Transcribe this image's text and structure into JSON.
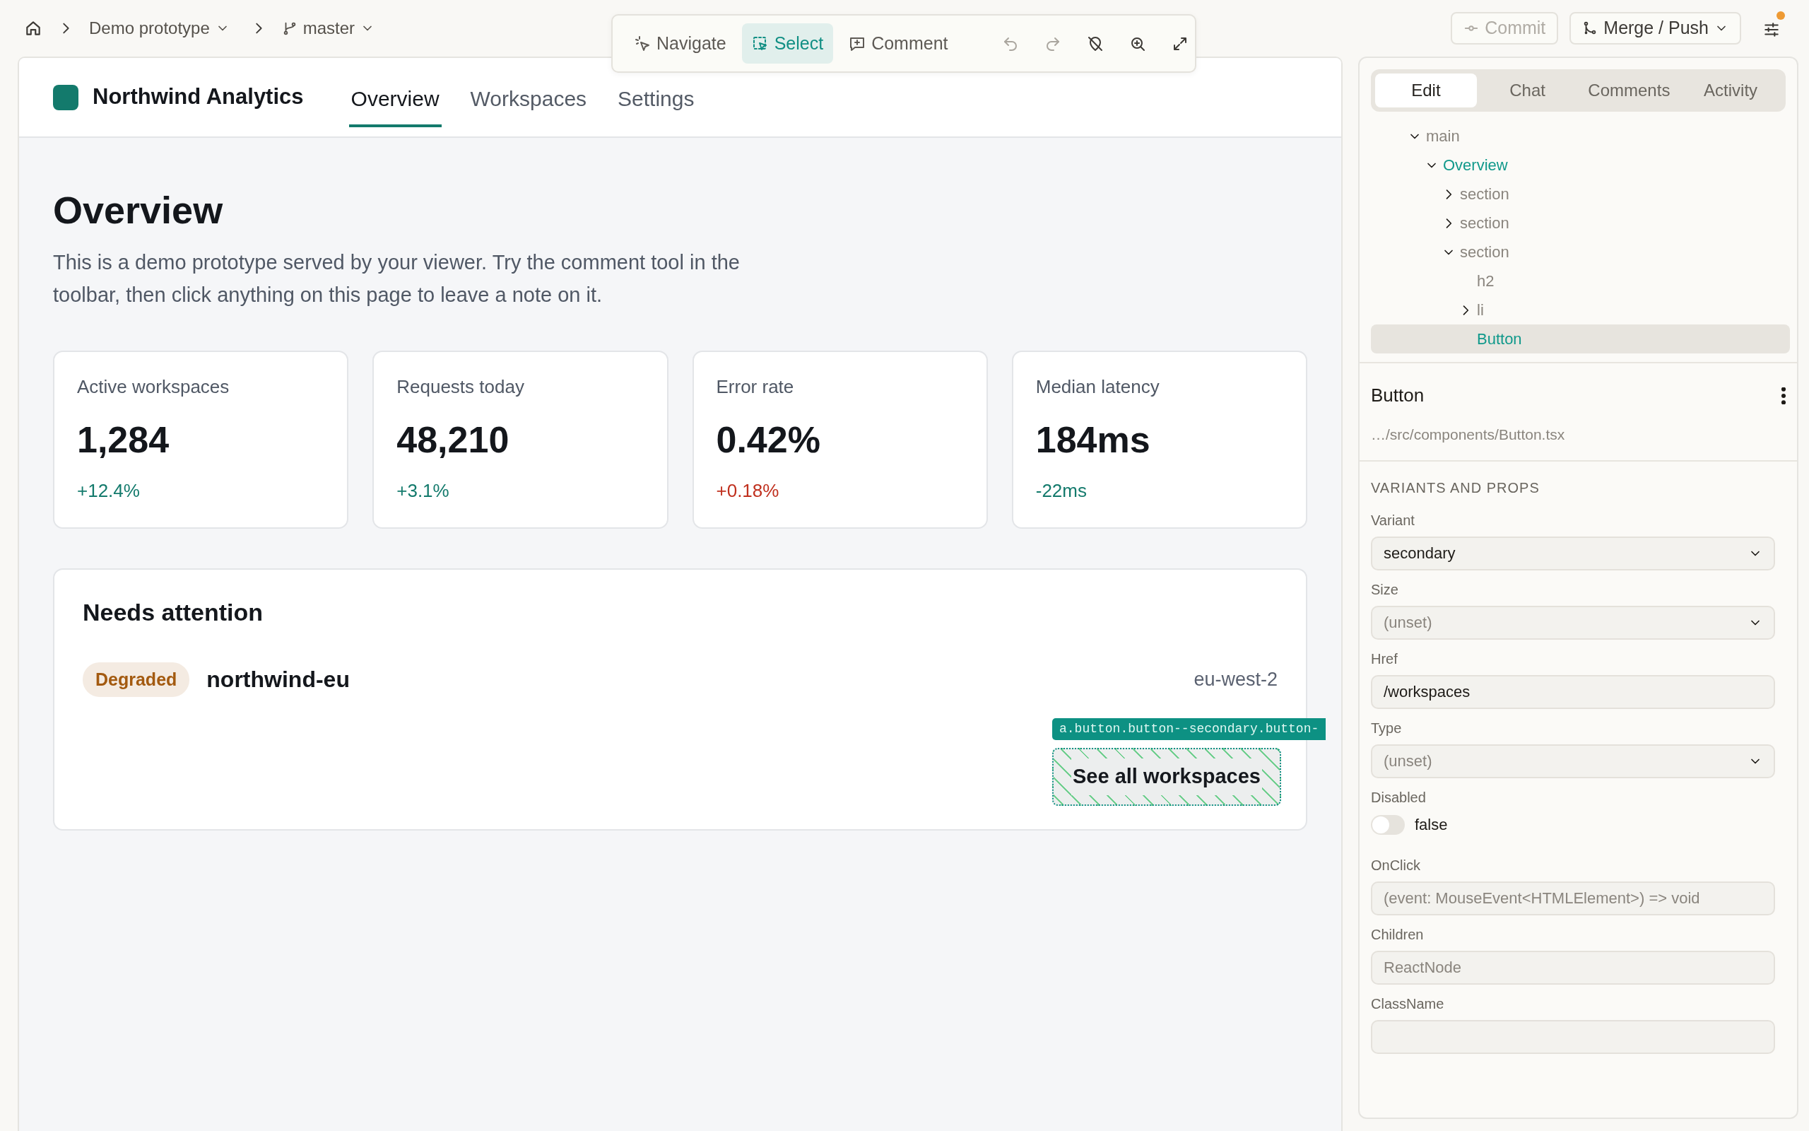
{
  "breadcrumb": {
    "project": "Demo prototype",
    "branch": "master"
  },
  "toolbar": {
    "modes": [
      {
        "label": "Navigate",
        "kind": "navigate",
        "selected": false
      },
      {
        "label": "Select",
        "kind": "select",
        "selected": true
      },
      {
        "label": "Comment",
        "kind": "comment",
        "selected": false
      }
    ],
    "actions": [
      {
        "kind": "undo",
        "disabled": true
      },
      {
        "kind": "redo",
        "disabled": true
      },
      {
        "kind": "hide",
        "disabled": false
      },
      {
        "kind": "zoom",
        "disabled": false
      },
      {
        "kind": "expand",
        "disabled": false
      }
    ]
  },
  "top_actions": {
    "commit": {
      "label": "Commit",
      "disabled": true
    },
    "merge": {
      "label": "Merge / Push"
    },
    "settings": {
      "notification": true
    }
  },
  "preview": {
    "app_name": "Northwind Analytics",
    "nav": [
      {
        "label": "Overview",
        "selected": true
      },
      {
        "label": "Workspaces",
        "selected": false
      },
      {
        "label": "Settings",
        "selected": false
      }
    ],
    "heading": "Overview",
    "intro": "This is a demo prototype served by your viewer. Try the comment tool in the toolbar, then click anything on this page to leave a note on it.",
    "stats": [
      {
        "label": "Active workspaces",
        "value": "1,284",
        "delta": "+12.4%",
        "color": "#137a6c"
      },
      {
        "label": "Requests today",
        "value": "48,210",
        "delta": "+3.1%",
        "color": "#137a6c"
      },
      {
        "label": "Error rate",
        "value": "0.42%",
        "delta": "+0.18%",
        "color": "#c0301e"
      },
      {
        "label": "Median latency",
        "value": "184ms",
        "delta": "-22ms",
        "color": "#137a6c"
      }
    ],
    "attention": {
      "title": "Needs attention",
      "items": [
        {
          "status": "Degraded",
          "color": "#a35a10",
          "name": "northwind-eu",
          "region": "eu-west-2"
        }
      ],
      "selector_label": "a.button.button--secondary.button-",
      "button": "See all workspaces"
    }
  },
  "sidebar": {
    "tabs": [
      {
        "label": "Edit",
        "selected": true
      },
      {
        "label": "Chat",
        "selected": false
      },
      {
        "label": "Comments",
        "selected": false
      },
      {
        "label": "Activity",
        "selected": false
      }
    ],
    "tree": [
      {
        "label": "main",
        "kind": "element",
        "expanded": true,
        "selected": false,
        "children": [
          {
            "label": "Overview",
            "kind": "component",
            "expanded": true,
            "selected": false,
            "children": [
              {
                "label": "section",
                "kind": "element",
                "expanded": false,
                "selected": false
              },
              {
                "label": "section",
                "kind": "element",
                "expanded": false,
                "selected": false
              },
              {
                "label": "section",
                "kind": "element",
                "expanded": true,
                "selected": false,
                "children": [
                  {
                    "label": "h2",
                    "kind": "element",
                    "selected": false
                  },
                  {
                    "label": "li",
                    "kind": "element",
                    "expanded": false,
                    "selected": false
                  },
                  {
                    "label": "Button",
                    "kind": "component",
                    "selected": true
                  }
                ]
              }
            ]
          }
        ]
      }
    ],
    "component": {
      "name": "Button",
      "path": "…/src/components/Button.tsx"
    },
    "props_heading": "VARIANTS AND PROPS",
    "props": [
      {
        "label": "Variant",
        "kind": "select",
        "value": "secondary"
      },
      {
        "label": "Size",
        "kind": "select",
        "placeholder": "(unset)"
      },
      {
        "label": "Href",
        "kind": "text",
        "value": "/workspaces"
      },
      {
        "label": "Type",
        "kind": "select",
        "placeholder": "(unset)"
      },
      {
        "label": "Disabled",
        "kind": "toggle",
        "on": false,
        "value": "false"
      },
      {
        "label": "OnClick",
        "kind": "text",
        "placeholder": "(event: MouseEvent<HTMLElement>) => void"
      },
      {
        "label": "Children",
        "kind": "text",
        "placeholder": "ReactNode"
      },
      {
        "label": "ClassName",
        "kind": "text"
      }
    ]
  }
}
